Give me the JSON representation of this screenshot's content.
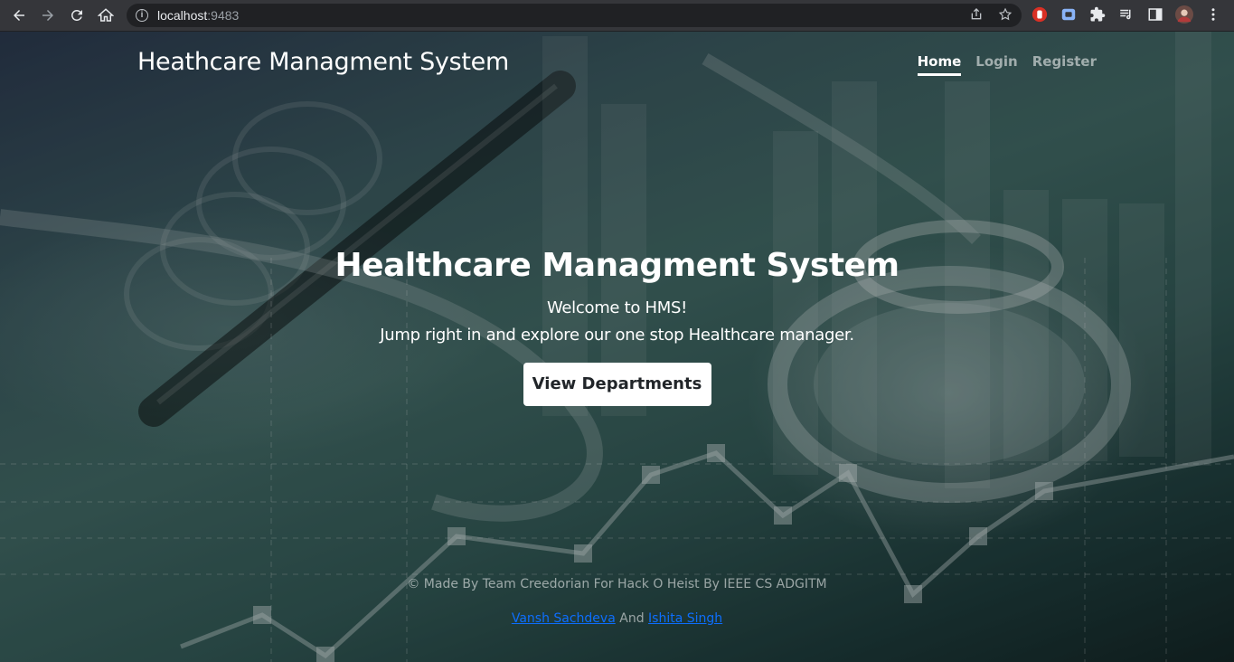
{
  "browser": {
    "url_host": "localhost",
    "url_port": ":9483"
  },
  "header": {
    "brand": "Heathcare Managment System",
    "nav": [
      "Home",
      "Login",
      "Register"
    ]
  },
  "hero": {
    "title": "Healthcare Managment System",
    "line1": "Welcome to HMS!",
    "line2": "Jump right in and explore our one stop Healthcare manager.",
    "button": "View Departments"
  },
  "footer": {
    "copyright": "© Made By Team Creedorian For Hack O Heist By IEEE CS ADGITM",
    "author1": "Vansh Sachdeva",
    "joiner": "And",
    "author2": "Ishita Singh"
  }
}
